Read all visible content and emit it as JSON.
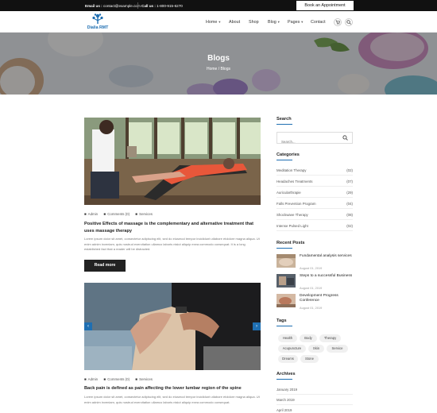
{
  "topbar": {
    "email_label": "Email us :",
    "email_value": "contact@example.com",
    "call_label": "Call us :",
    "call_value": "1-800-915-6270",
    "appointment_button": "Book an Appointment"
  },
  "header": {
    "logo_text": "Dialia RMT",
    "nav": [
      "Home",
      "About",
      "Shop",
      "Blog",
      "Pages",
      "Contact"
    ]
  },
  "hero": {
    "title": "Blogs",
    "breadcrumb": "Home / Blogs"
  },
  "posts": [
    {
      "author": "Admin",
      "comments": "Comments (0)",
      "category": "Services",
      "title": "Positive Effects of massage is the complementary and alternative treatment that uses massage therapy",
      "excerpt": "Lorem ipsum dolor sit amet, consectetur adipiscing elit, sed do eiusmod tempor incididunt utlabore etdolore magna aliqua. Ut enim adnim inveniam, quis nostrud exercitation ullamco laboris nisiut aliquip exea commodo consequat. It is a long established fact that a reader will be distracted.",
      "read_more": "Read more"
    },
    {
      "author": "Admin",
      "comments": "Comments (0)",
      "category": "Services",
      "title": "Back pain is defined as pain affecting the lower lumbar region of the spine",
      "excerpt": "Lorem ipsum dolor sit amet, consectetur adipiscing elit, sed do eiusmod tempor incididunt utlabore etdolore magna aliqua. Ut enim adnim inveniam, quis nostrud exercitation ullamco laboris nisiut aliquip exea commodo consequat."
    }
  ],
  "sidebar": {
    "search": {
      "title": "Search",
      "placeholder": "Search..."
    },
    "categories": {
      "title": "Categories",
      "items": [
        {
          "name": "Meditation Therapy",
          "count": "(02)"
        },
        {
          "name": "Headaches Treatments",
          "count": "(07)"
        },
        {
          "name": "Auricularthrapie",
          "count": "(29)"
        },
        {
          "name": "Falls Prevention Program",
          "count": "(04)"
        },
        {
          "name": "Shockwave Therapy",
          "count": "(08)"
        },
        {
          "name": "Intense Pulsed Light",
          "count": "(02)"
        }
      ]
    },
    "recent_posts": {
      "title": "Recent Posts",
      "items": [
        {
          "title": "Fundamental analysis services",
          "date": "August 01, 2019"
        },
        {
          "title": "Steps to a successful Business",
          "date": "August 01, 2019"
        },
        {
          "title": "Development Progress Conference",
          "date": "August 01, 2019"
        }
      ]
    },
    "tags": {
      "title": "Tags",
      "items": [
        "Health",
        "Body",
        "Therapy",
        "Acupuncture",
        "Skin",
        "Service",
        "Dreams",
        "Stone"
      ]
    },
    "archives": {
      "title": "Archives",
      "items": [
        "January 2019",
        "March 2019",
        "April 2019"
      ]
    }
  },
  "colors": {
    "accent": "#1f6fb2",
    "dark": "#111111"
  }
}
